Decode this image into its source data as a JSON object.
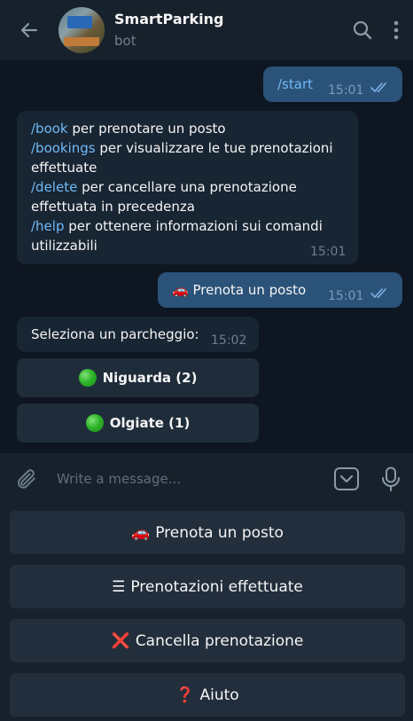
{
  "header": {
    "title": "SmartParking",
    "subtitle": "bot",
    "back_icon": "arrow-left-icon",
    "search_icon": "search-icon",
    "menu_icon": "more-vertical-icon"
  },
  "messages": [
    {
      "direction": "out",
      "text": "/start",
      "time": "15:01",
      "status": "read"
    },
    {
      "direction": "in",
      "lines": [
        {
          "cmd": "/book",
          "text": " per prenotare un posto"
        },
        {
          "cmd": "/bookings",
          "text": " per visualizzare le tue prenotazioni effettuate"
        },
        {
          "cmd": "/delete",
          "text": " per cancellare una prenotazione effettuata in precedenza"
        },
        {
          "cmd": "/help",
          "text": " per ottenere informazioni sui comandi utilizzabili"
        }
      ],
      "time": "15:01"
    },
    {
      "direction": "out",
      "emoji": "🚗",
      "text": "Prenota un posto",
      "time": "15:01",
      "status": "read"
    },
    {
      "direction": "in",
      "text": "Seleziona un parcheggio:",
      "time": "15:02"
    }
  ],
  "inline_buttons": [
    {
      "label": "Niguarda (2)",
      "icon": "green-circle"
    },
    {
      "label": "Olgiate (1)",
      "icon": "green-circle"
    }
  ],
  "composer": {
    "placeholder": "Write a message...",
    "value": ""
  },
  "keyboard": [
    {
      "emoji": "🚗",
      "label": "Prenota un posto"
    },
    {
      "emoji": "☰",
      "label": "Prenotazioni effettuate"
    },
    {
      "emoji": "❌",
      "label": "Cancella prenotazione"
    },
    {
      "emoji": "❓",
      "label": "Aiuto"
    }
  ],
  "colors": {
    "background": "#0e1621",
    "header": "#17212b",
    "outgoing_bubble": "#2b5278",
    "incoming_bubble": "#182533",
    "command_link": "#71baf5",
    "keyboard_button": "#232e3c"
  }
}
